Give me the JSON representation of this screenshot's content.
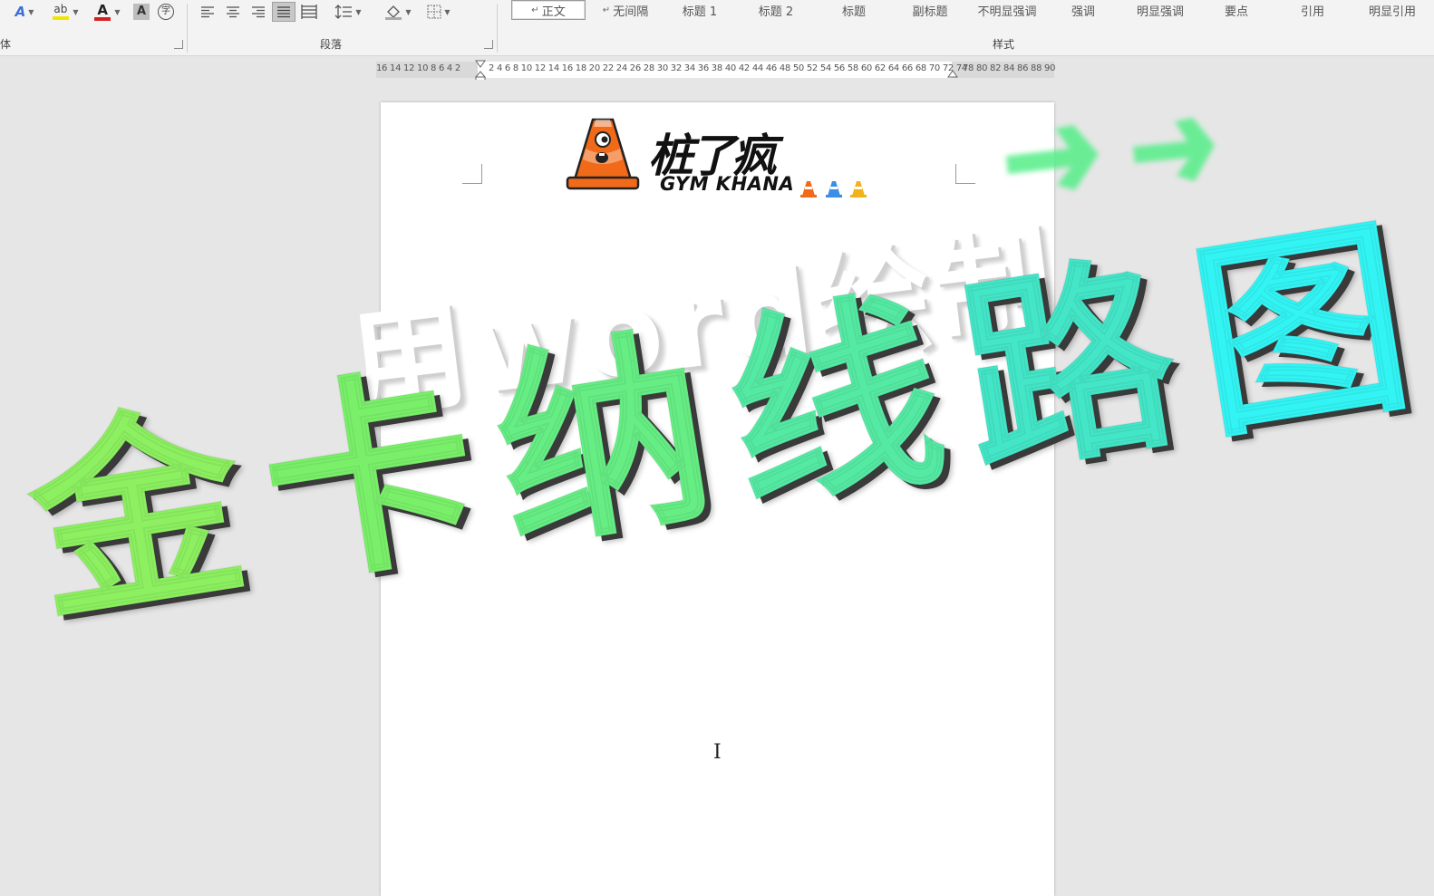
{
  "ribbon": {
    "font_group": {
      "label_partial": "体",
      "icons": [
        {
          "name": "text-effects-icon",
          "glyph": "A",
          "color": "#3b6fd8"
        },
        {
          "name": "highlight-color-icon",
          "glyph": "ab",
          "color": "#444444"
        },
        {
          "name": "font-color-icon",
          "glyph": "A",
          "color": "#d62020"
        },
        {
          "name": "character-shading-icon",
          "glyph": "A",
          "color": "#555555"
        },
        {
          "name": "enclose-characters-icon",
          "glyph": "字",
          "color": "#555555"
        }
      ]
    },
    "paragraph_group": {
      "label": "段落",
      "icons": [
        {
          "name": "align-left-icon"
        },
        {
          "name": "align-center-icon"
        },
        {
          "name": "align-right-icon"
        },
        {
          "name": "justify-icon"
        },
        {
          "name": "distributed-icon"
        },
        {
          "name": "line-spacing-icon"
        },
        {
          "name": "shading-icon"
        },
        {
          "name": "borders-icon"
        }
      ]
    },
    "styles_group": {
      "label": "样式",
      "items": [
        "正文",
        "无间隔",
        "标题 1",
        "标题 2",
        "标题",
        "副标题",
        "不明显强调",
        "强调",
        "明显强调",
        "要点",
        "引用",
        "明显引用"
      ],
      "active_index": 0
    }
  },
  "ruler": {
    "left_numbers": "16 14 12 10  8  6  4  2",
    "right_numbers": "2  4  6  8 10 12 14 16 18 20 22 24 26 28 30 32 34 36 38 40 42 44 46 48 50 52 54 56 58 60 62 64 66 68 70 72 74",
    "tail_numbers": "78 80 82 84 86 88 90"
  },
  "logo": {
    "brand_cn": "桩了疯",
    "brand_en": "GYM KHANA"
  },
  "overlay": {
    "subtitle": "用word绘制",
    "title_chars": [
      "金",
      "卡",
      "纳",
      "线",
      "路",
      "图"
    ],
    "title_colors": [
      "#8cf060",
      "#7af06a",
      "#66ee84",
      "#55eaa4",
      "#44e6c8",
      "#33f4f4"
    ]
  },
  "colors": {
    "ribbon_bg": "#f3f3f3",
    "workspace_bg": "#e6e6e6",
    "page_bg": "#ffffff",
    "cone_orange": "#f06a1a",
    "arrow_green": "#55ee88"
  }
}
